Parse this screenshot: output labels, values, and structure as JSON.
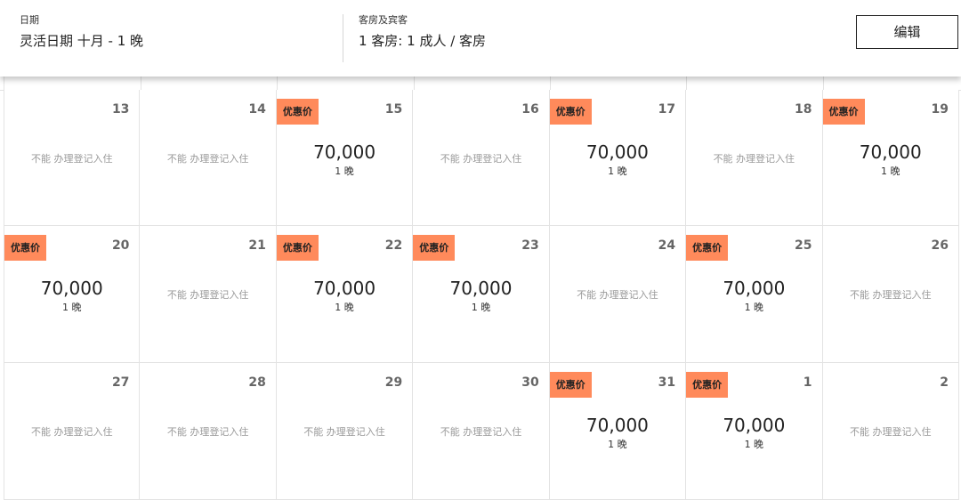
{
  "header": {
    "dates_label": "日期",
    "dates_value": "灵活日期 十月 - 1 晚",
    "rooms_label": "客房及宾客",
    "rooms_value": "1 客房: 1 成人 / 客房",
    "edit_label": "编辑"
  },
  "calendar": {
    "badge_label": "优惠价",
    "unavailable_label": "不能 办理登记入住",
    "nights_label": "1 晚",
    "days": [
      {
        "day": "13",
        "deal": false,
        "price": ""
      },
      {
        "day": "14",
        "deal": false,
        "price": ""
      },
      {
        "day": "15",
        "deal": true,
        "price": "70,000"
      },
      {
        "day": "16",
        "deal": false,
        "price": ""
      },
      {
        "day": "17",
        "deal": true,
        "price": "70,000"
      },
      {
        "day": "18",
        "deal": false,
        "price": ""
      },
      {
        "day": "19",
        "deal": true,
        "price": "70,000"
      },
      {
        "day": "20",
        "deal": true,
        "price": "70,000"
      },
      {
        "day": "21",
        "deal": false,
        "price": ""
      },
      {
        "day": "22",
        "deal": true,
        "price": "70,000"
      },
      {
        "day": "23",
        "deal": true,
        "price": "70,000"
      },
      {
        "day": "24",
        "deal": false,
        "price": ""
      },
      {
        "day": "25",
        "deal": true,
        "price": "70,000"
      },
      {
        "day": "26",
        "deal": false,
        "price": ""
      },
      {
        "day": "27",
        "deal": false,
        "price": ""
      },
      {
        "day": "28",
        "deal": false,
        "price": ""
      },
      {
        "day": "29",
        "deal": false,
        "price": ""
      },
      {
        "day": "30",
        "deal": false,
        "price": ""
      },
      {
        "day": "31",
        "deal": true,
        "price": "70,000"
      },
      {
        "day": "1",
        "deal": true,
        "price": "70,000"
      },
      {
        "day": "2",
        "deal": false,
        "price": ""
      }
    ]
  },
  "colors": {
    "badge": "#ff8a5b",
    "muted_text": "#9a9a9a",
    "grid_line": "#e3e3e3"
  }
}
